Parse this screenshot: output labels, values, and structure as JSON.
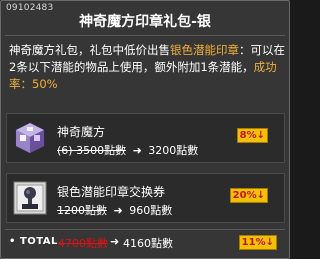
{
  "item_code": "09102483",
  "title": "神奇魔方印章礼包-银",
  "description": {
    "part1": "神奇魔方礼包，礼包中低价出售",
    "highlight": "银色潜能印章",
    "part2": "：可以在2条以下潜能的物品上使用，额外附加1条潜能，",
    "rate": "成功率：50%"
  },
  "items": [
    {
      "name": "神奇魔方",
      "old_price": "(6) 3500點數",
      "new_price": "3200點數",
      "discount": "8%",
      "icon": "cube-icon"
    },
    {
      "name": "银色潜能印章交换券",
      "old_price": "1200點數",
      "new_price": "960點數",
      "discount": "20%",
      "icon": "stamp-coupon-icon"
    }
  ],
  "total": {
    "label": "TOTAL",
    "old_price": "4700點數",
    "new_price": "4160點數",
    "discount": "11%"
  },
  "colors": {
    "background": "#363636",
    "highlight": "#f0b03c",
    "badge_bg": "#f2c200",
    "badge_text": "#c91414"
  }
}
